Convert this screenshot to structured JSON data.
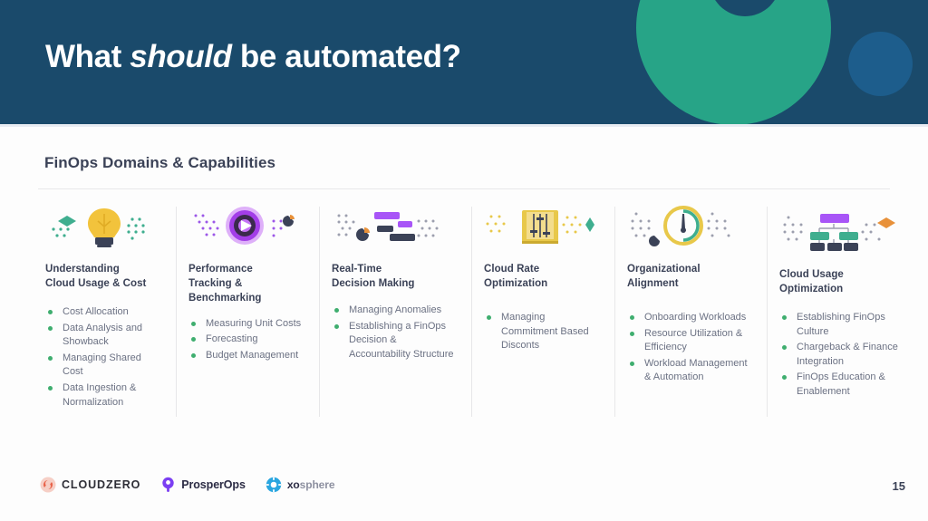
{
  "header": {
    "title_pre": "What ",
    "title_em": "should",
    "title_post": " be automated?",
    "bg_color": "#1a4a6b",
    "ring_color": "#27a487",
    "circle_color": "#1d5d8c"
  },
  "section": {
    "title": "FinOps Domains & Capabilities"
  },
  "columns": [
    {
      "icon": "lightbulb-icon",
      "heading": "Understanding\nCloud Usage & Cost",
      "heading_line1": "Understanding",
      "heading_line2": "Cloud Usage & Cost",
      "items": [
        "Cost Allocation",
        "Data Analysis and Showback",
        "Managing Shared Cost",
        "Data Ingestion & Normalization"
      ]
    },
    {
      "icon": "target-play-icon",
      "heading_line1": "Performance",
      "heading_line2": "Tracking &",
      "heading_line3": "Benchmarking",
      "items": [
        "Measuring Unit Costs",
        "Forecasting",
        "Budget Management"
      ]
    },
    {
      "icon": "gantt-chart-icon",
      "heading_line1": "Real-Time",
      "heading_line2": "Decision Making",
      "items": [
        "Managing Anomalies",
        "Establishing a FinOps Decision & Accountability Structure"
      ]
    },
    {
      "icon": "sliders-panel-icon",
      "heading_line1": "Cloud Rate",
      "heading_line2": "Optimization",
      "items": [
        "Managing Commitment Based Disconts"
      ]
    },
    {
      "icon": "gauge-clock-icon",
      "heading_line1": "Organizational",
      "heading_line2": "Alignment",
      "items": [
        "Onboarding Workloads",
        "Resource Utilization & Efficiency",
        "Workload Management & Automation"
      ]
    },
    {
      "icon": "org-chart-icon",
      "heading_line1": "Cloud Usage",
      "heading_line2": "Optimization",
      "items": [
        "Establishing FinOps Culture",
        "Chargeback & Finance Integration",
        "FinOps Education & Enablement"
      ]
    }
  ],
  "footer": {
    "logos": [
      {
        "name": "cloudzero-logo",
        "text": "CLOUDZERO",
        "color": "#e8634a"
      },
      {
        "name": "prosperops-logo",
        "text": "ProsperOps",
        "color": "#7b3ff2"
      },
      {
        "name": "xosphere-logo",
        "text_bold": "xo",
        "text_light": "sphere",
        "color": "#2aa6e0"
      }
    ],
    "page_number": "15"
  },
  "colors": {
    "bullet_green": "#3fae6f",
    "heading_slate": "#3b4257",
    "body_gray": "#6b7183",
    "divider": "#e7e7e9"
  }
}
